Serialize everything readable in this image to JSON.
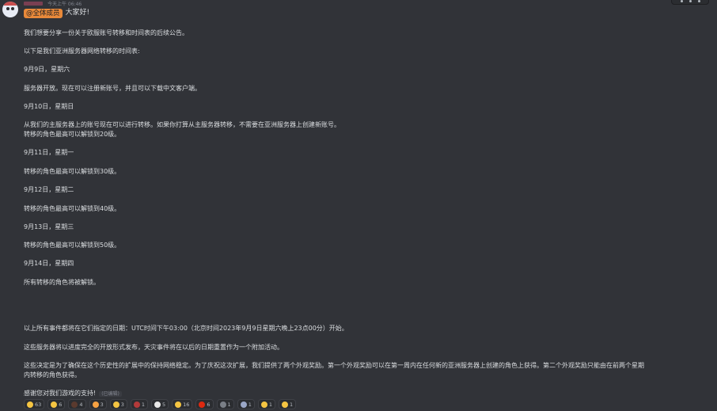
{
  "message": {
    "timestamp": "今天上午 06:46",
    "mention": "@全体成员",
    "greeting": "大家好!",
    "edited_label": "(已编辑)"
  },
  "paragraphs": [
    {
      "text": "我们想要分享一份关于欧服账号转移和时间表的后续公告。"
    },
    {
      "text": "以下是我们亚洲服务器网络转移的时间表:"
    },
    {
      "text": "9月9日，星期六"
    },
    {
      "text": "服务器开放。现在可以注册新账号，并且可以下载中文客户端。"
    },
    {
      "text": "9月10日，星期日"
    },
    {
      "text": "从我们的主服务器上的账号现在可以进行转移。如果你打算从主服务器转移，不需要在亚洲服务器上创建新账号。\n转移的角色最高可以解锁到20级。"
    },
    {
      "text": "9月11日，星期一"
    },
    {
      "text": "转移的角色最高可以解锁到30级。"
    },
    {
      "text": "9月12日，星期二"
    },
    {
      "text": "转移的角色最高可以解锁到40级。"
    },
    {
      "text": "9月13日，星期三"
    },
    {
      "text": "转移的角色最高可以解锁到50级。"
    },
    {
      "text": "9月14日，星期四"
    },
    {
      "text": "所有转移的角色将被解锁。"
    },
    {
      "text": "以上所有事件都将在它们指定的日期：UTC时间下午03:00（北京时间2023年9月9日星期六晚上23点00分）开始。"
    },
    {
      "text": "这些服务器将以进度完全的开放形式发布，天灾事件将在以后的日期重置作为一个附加活动。"
    },
    {
      "text": "这些决定是为了确保在这个历史性的扩展中的保持网络稳定。为了庆祝这次扩展，我们提供了两个外观奖励。第一个外观奖励可以在第一周内在任何新的亚洲服务器上创建的角色上获得。第二个外观奖励只能由在前两个星期\n内转移的角色获得。"
    },
    {
      "text": "感谢您对我们游戏的支持!"
    }
  ],
  "reactions": [
    {
      "emoji": "thumbs-up-icon",
      "count": "63",
      "color": "#f5c542"
    },
    {
      "emoji": "smile-icon",
      "count": "6",
      "color": "#f5c542"
    },
    {
      "emoji": "dark-face-icon",
      "count": "4",
      "color": "#5a3a2e"
    },
    {
      "emoji": "heart-eyes-icon",
      "count": "3",
      "color": "#f5a142"
    },
    {
      "emoji": "grin-icon",
      "count": "3",
      "color": "#f5c542"
    },
    {
      "emoji": "red-square-icon",
      "count": "1",
      "color": "#b33a3a"
    },
    {
      "emoji": "clown-icon",
      "count": "5",
      "color": "#e8e8e8"
    },
    {
      "emoji": "thumbs-down-icon",
      "count": "16",
      "color": "#f5c542"
    },
    {
      "emoji": "china-flag-icon",
      "count": "6",
      "color": "#de2910"
    },
    {
      "emoji": "small-dot-icon",
      "count": "1",
      "color": "#7a7f87"
    },
    {
      "emoji": "rocket-icon",
      "count": "1",
      "color": "#9aa7c7"
    },
    {
      "emoji": "dizzy-face-icon",
      "count": "1",
      "color": "#f5c542"
    },
    {
      "emoji": "worried-face-icon",
      "count": "1",
      "color": "#f5c542"
    }
  ]
}
